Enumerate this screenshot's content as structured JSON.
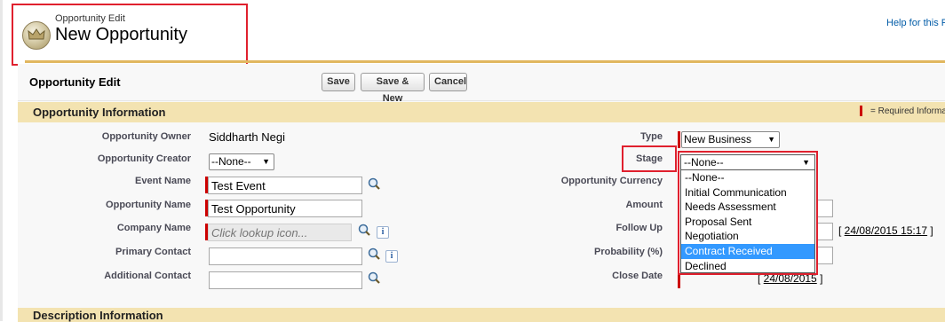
{
  "header": {
    "subtitle": "Opportunity Edit",
    "title": "New Opportunity",
    "help_link": "Help for this Page",
    "icon": "opportunity-crown-icon"
  },
  "block": {
    "title": "Opportunity Edit",
    "buttons": {
      "save": "Save",
      "save_new": "Save & New",
      "cancel": "Cancel"
    }
  },
  "section": {
    "title": "Opportunity Information",
    "required_text": "= Required Information"
  },
  "fields_left": {
    "owner_label": "Opportunity Owner",
    "owner_value": "Siddharth Negi",
    "creator_label": "Opportunity Creator",
    "creator_value": "--None--",
    "event_label": "Event Name",
    "event_value": "Test Event",
    "name_label": "Opportunity Name",
    "name_value": "Test Opportunity",
    "company_label": "Company Name",
    "company_placeholder": "Click lookup icon...",
    "primary_label": "Primary Contact",
    "primary_value": "",
    "additional_label": "Additional Contact",
    "additional_value": ""
  },
  "fields_right": {
    "type_label": "Type",
    "type_value": "New Business",
    "stage_label": "Stage",
    "stage_value": "--None--",
    "currency_label": "Opportunity Currency",
    "amount_label": "Amount",
    "followup_label": "Follow Up",
    "followup_date": "24/08/2015 15:17",
    "probability_label": "Probability (%)",
    "close_label": "Close Date",
    "close_date": "24/08/2015"
  },
  "stage_options": [
    "--None--",
    "Initial Communication",
    "Needs Assessment",
    "Proposal Sent",
    "Negotiation",
    "Contract Received",
    "Declined"
  ],
  "stage_highlighted": "Contract Received",
  "section2": {
    "title": "Description Information"
  },
  "colors": {
    "required": "#cc0000",
    "section_bar": "#f3e3b1",
    "annotation_box": "#e0202e",
    "highlight": "#3399ff",
    "header_rule": "#e1b75f"
  }
}
